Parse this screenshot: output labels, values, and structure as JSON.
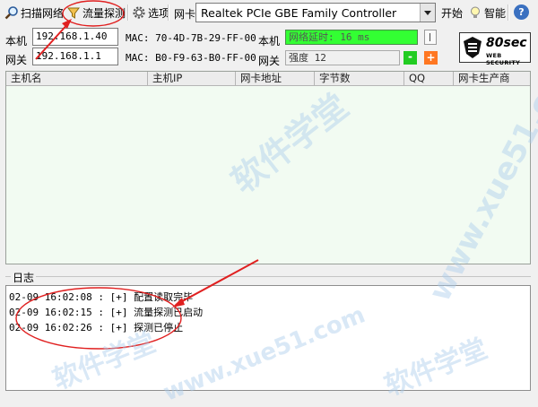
{
  "toolbar": {
    "scan_label": "扫描网络",
    "sniff_label": "流量探测",
    "options_label": "选项",
    "nic_label": "网卡",
    "nic_value": "Realtek PCIe GBE Family Controller",
    "start_label": "开始",
    "smart_label": "智能",
    "help_symbol": "?"
  },
  "host": {
    "local_label": "本机",
    "local_ip": "192.168.1.40",
    "local_mac": "MAC: 70-4D-7B-29-FF-00",
    "gateway_label": "网关",
    "gateway_ip": "192.168.1.1",
    "gateway_mac": "MAC: B0-F9-63-B0-FF-00",
    "delay_label": "本机",
    "delay_text": "网络延时: 16 ms",
    "strength_label": "网关",
    "strength_text": "强度 12",
    "minus_symbol": "-",
    "plus_symbol": "+"
  },
  "logo": {
    "number": "80sec",
    "subtitle": "WEB SECURITY"
  },
  "table": {
    "columns": [
      "主机名",
      "主机IP",
      "网卡地址",
      "字节数",
      "QQ",
      "网卡生产商"
    ],
    "rows": []
  },
  "log": {
    "title": "日志",
    "lines": [
      "02-09 16:02:08 : [+] 配置读取完毕",
      "02-09 16:02:15 : [+] 流量探测已启动",
      "02-09 16:02:26 : [+] 探测已停止"
    ]
  },
  "watermark": {
    "text_cn": "软件学堂",
    "text_url": "www.xue51.com"
  },
  "colors": {
    "status_green": "#33ff33",
    "minus_green": "#22cc22",
    "plus_orange": "#ff7722",
    "annotation_red": "#e02020"
  }
}
